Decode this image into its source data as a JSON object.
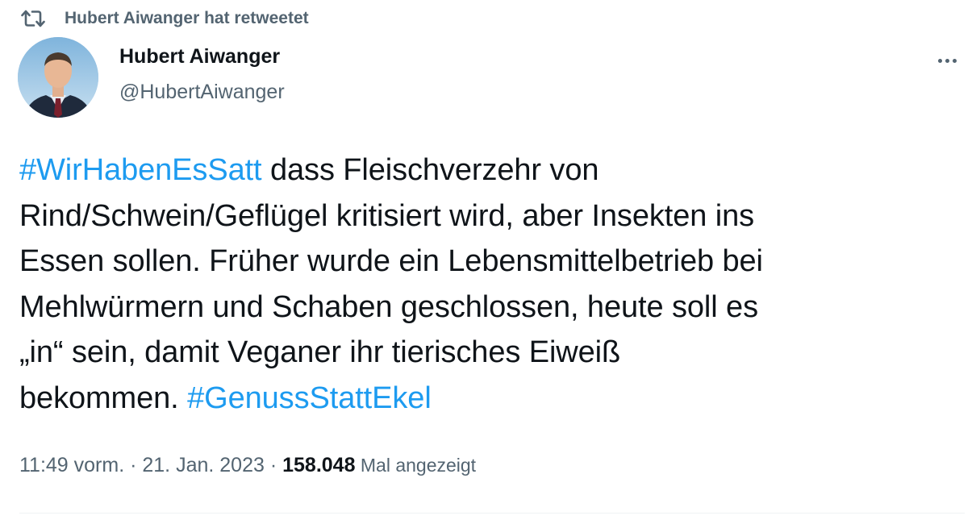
{
  "retweet": {
    "icon": "retweet-icon",
    "text": "Hubert Aiwanger hat retweetet"
  },
  "author": {
    "name": "Hubert Aiwanger",
    "handle": "@HubertAiwanger",
    "avatar_icon": "profile-photo"
  },
  "more_icon": "more-options-icon",
  "tweet": {
    "lines": [
      {
        "hashtag": "#WirHabenEsSatt",
        "text": " dass Fleischverzehr von"
      },
      {
        "text": "Rind/Schwein/Geflügel kritisiert wird, aber Insekten ins"
      },
      {
        "text": "Essen sollen. Früher wurde ein Lebensmittelbetrieb bei"
      },
      {
        "text": "Mehlwürmern und Schaben geschlossen, heute soll es"
      },
      {
        "text": "„in“ sein, damit Veganer ihr tierisches Eiweiß"
      },
      {
        "text": "bekommen. ",
        "hashtag_end": "#GenussStattEkel"
      }
    ]
  },
  "meta": {
    "time": "11:49 vorm.",
    "separator1": " · ",
    "date": "21. Jan. 2023",
    "separator2": " · ",
    "views_count": "158.048",
    "views_label": " Mal angezeigt"
  },
  "colors": {
    "link": "#1d9bf0",
    "text": "#0f1419",
    "secondary": "#536471",
    "divider": "#eff3f4"
  }
}
